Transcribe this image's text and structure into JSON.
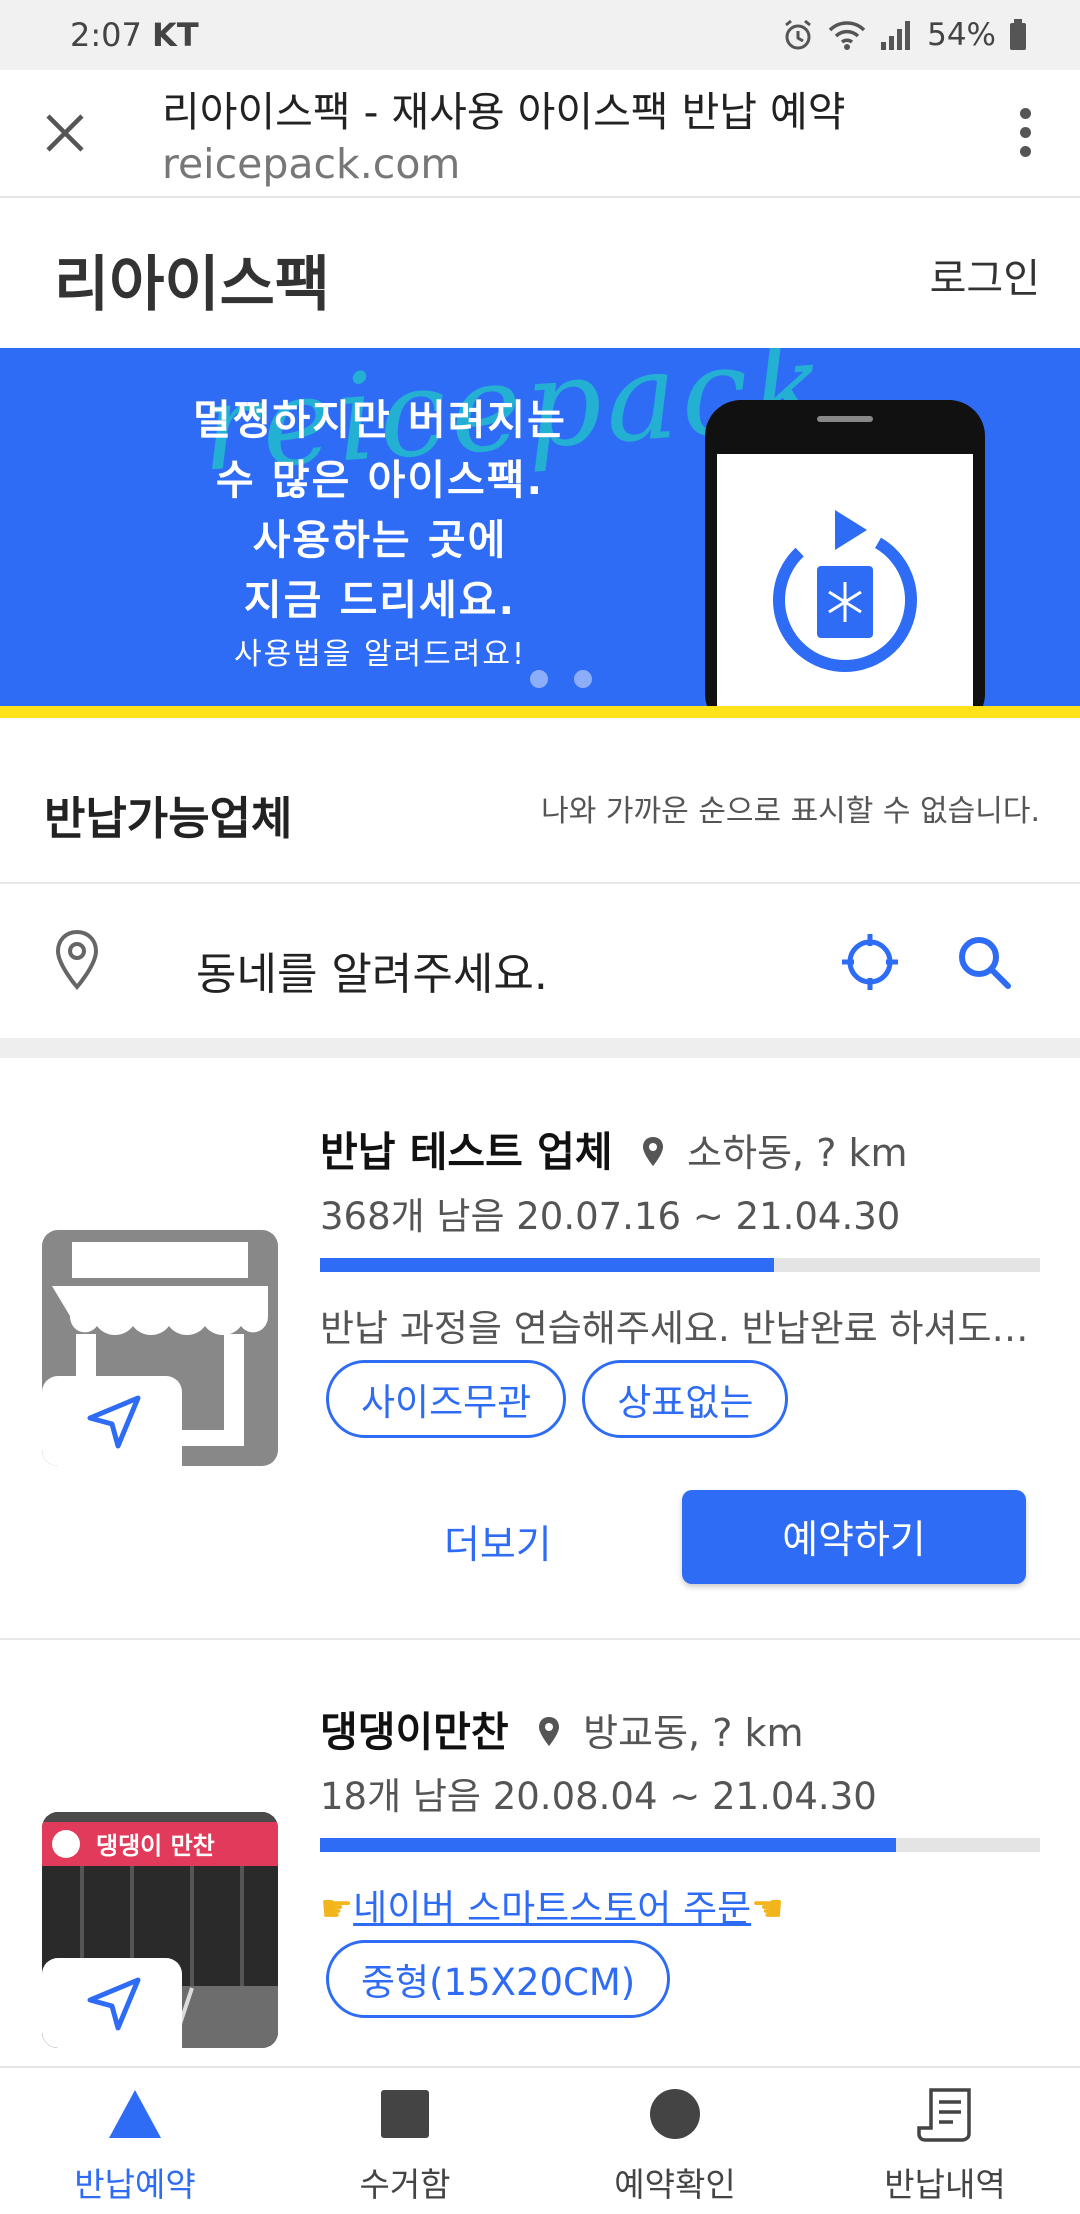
{
  "status_bar": {
    "time": "2:07",
    "carrier": "KT",
    "battery": "54%"
  },
  "browser": {
    "title": "리아이스팩 - 재사용 아이스팩 반납 예약",
    "url": "reicepack.com"
  },
  "site": {
    "logo": "리아이스팩",
    "login": "로그인"
  },
  "banner": {
    "watermark": "reicepack",
    "lines": [
      "멀쩡하지만 버려지는",
      "수 많은 아이스팩.",
      "사용하는 곳에",
      "지금 드리세요."
    ],
    "sub": "사용법을 알려드려요!",
    "accent": "#2f6cf5",
    "stripe": "#ffe21a"
  },
  "section": {
    "title": "반납가능업체",
    "note": "나와 가까운 순으로 표시할 수 없습니다."
  },
  "search": {
    "placeholder": "동네를 알려주세요."
  },
  "cards": [
    {
      "name": "반납 테스트 업체",
      "place": "소하동, ? km",
      "stock": "368개 남음 20.07.16 ~ 21.04.30",
      "progress": 0.63,
      "desc": "반납 과정을 연습해주세요. 반납완료 하셔도…",
      "tags": [
        "사이즈무관",
        "상표없는"
      ],
      "more": "더보기",
      "reserve": "예약하기"
    },
    {
      "name": "댕댕이만찬",
      "place": "방교동, ? km",
      "stock": "18개 남음 20.08.04 ~ 21.04.30",
      "progress": 0.8,
      "link": "네이버 스마트스토어 주문",
      "tags": [
        "중형(15X20CM)"
      ],
      "sign": "댕댕이 만찬"
    }
  ],
  "bottom_nav": [
    {
      "label": "반납예약",
      "icon": "triangle-icon",
      "active": true
    },
    {
      "label": "수거함",
      "icon": "square-icon",
      "active": false
    },
    {
      "label": "예약확인",
      "icon": "circle-icon",
      "active": false
    },
    {
      "label": "반납내역",
      "icon": "receipt-icon",
      "active": false
    }
  ]
}
